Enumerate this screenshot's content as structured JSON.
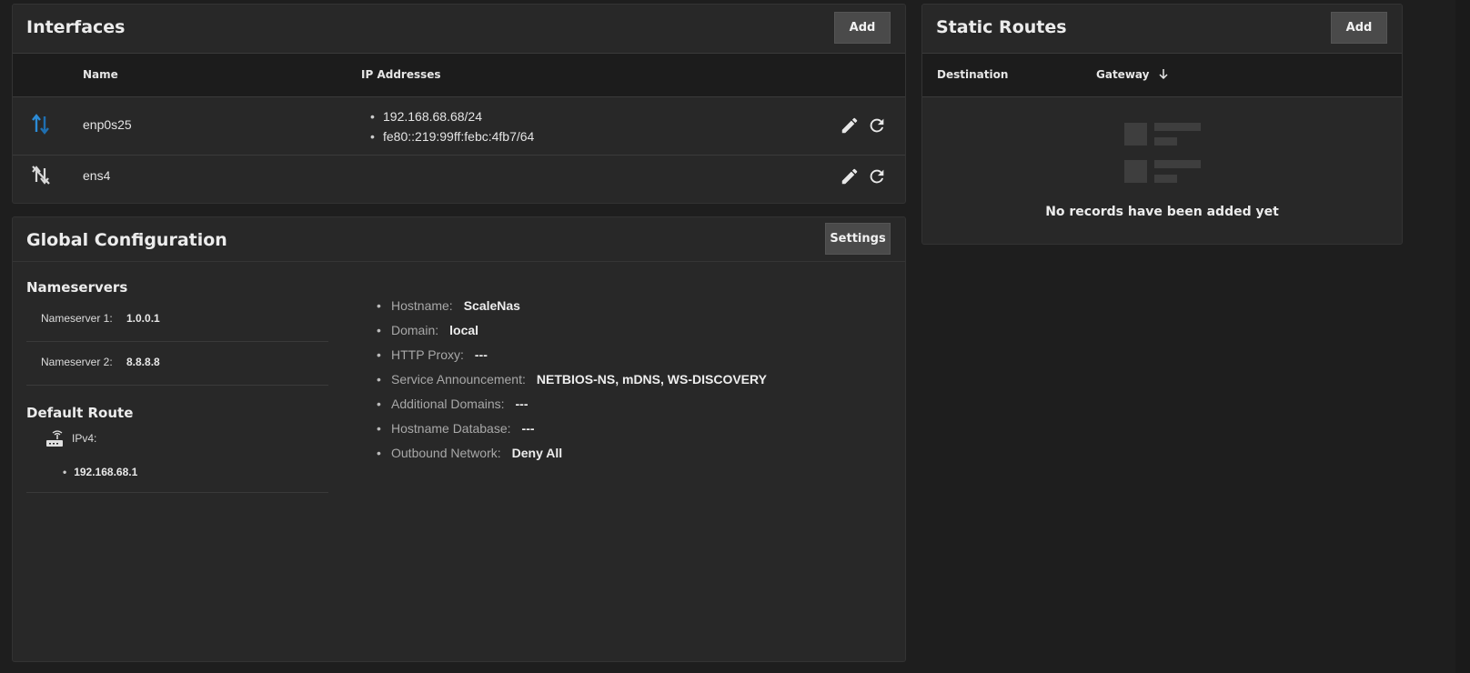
{
  "interfaces": {
    "title": "Interfaces",
    "add_label": "Add",
    "columns": {
      "name": "Name",
      "ip": "IP Addresses"
    },
    "rows": [
      {
        "name": "enp0s25",
        "ips": [
          "192.168.68.68/24",
          "fe80::219:99ff:febc:4fb7/64"
        ],
        "icon": "link-up-icon"
      },
      {
        "name": "ens4",
        "ips": [],
        "icon": "link-down-icon"
      }
    ]
  },
  "global": {
    "title": "Global Configuration",
    "settings_label": "Settings",
    "nameservers": {
      "heading": "Nameservers",
      "items": [
        {
          "label": "Nameserver 1:",
          "value": "1.0.0.1"
        },
        {
          "label": "Nameserver 2:",
          "value": "8.8.8.8"
        }
      ]
    },
    "default_route": {
      "heading": "Default Route",
      "ipv4_label": "IPv4:",
      "ipv4_value": "192.168.68.1"
    },
    "details": [
      {
        "key": "Hostname:",
        "value": "ScaleNas"
      },
      {
        "key": "Domain:",
        "value": "local"
      },
      {
        "key": "HTTP Proxy:",
        "value": "---"
      },
      {
        "key": "Service Announcement:",
        "value": "NETBIOS-NS, mDNS, WS-DISCOVERY"
      },
      {
        "key": "Additional Domains:",
        "value": "---"
      },
      {
        "key": "Hostname Database:",
        "value": "---"
      },
      {
        "key": "Outbound Network:",
        "value": "Deny All"
      }
    ]
  },
  "routes": {
    "title": "Static Routes",
    "add_label": "Add",
    "columns": {
      "destination": "Destination",
      "gateway": "Gateway"
    },
    "empty_text": "No records have been added yet"
  },
  "colors": {
    "background": "#1e1e1e",
    "card": "#282828",
    "accent": "#2c8bd6",
    "button": "#4a4a4a"
  }
}
